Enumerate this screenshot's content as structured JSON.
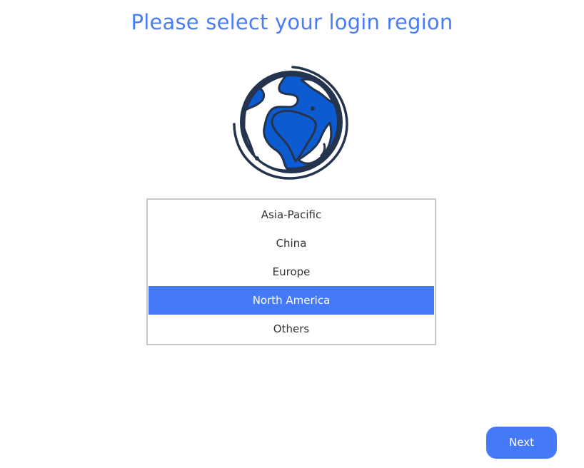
{
  "title": "Please select your login region",
  "globe_icon": "globe-icon",
  "regions": {
    "items": [
      {
        "label": "Asia-Pacific"
      },
      {
        "label": "China"
      },
      {
        "label": "Europe"
      },
      {
        "label": "North America"
      },
      {
        "label": "Others"
      }
    ],
    "selected": "North America"
  },
  "next_label": "Next",
  "colors": {
    "accent": "#4479f7",
    "title": "#4a7cf5",
    "globe_fill": "#0d5bd0",
    "globe_outline": "#24344f"
  }
}
